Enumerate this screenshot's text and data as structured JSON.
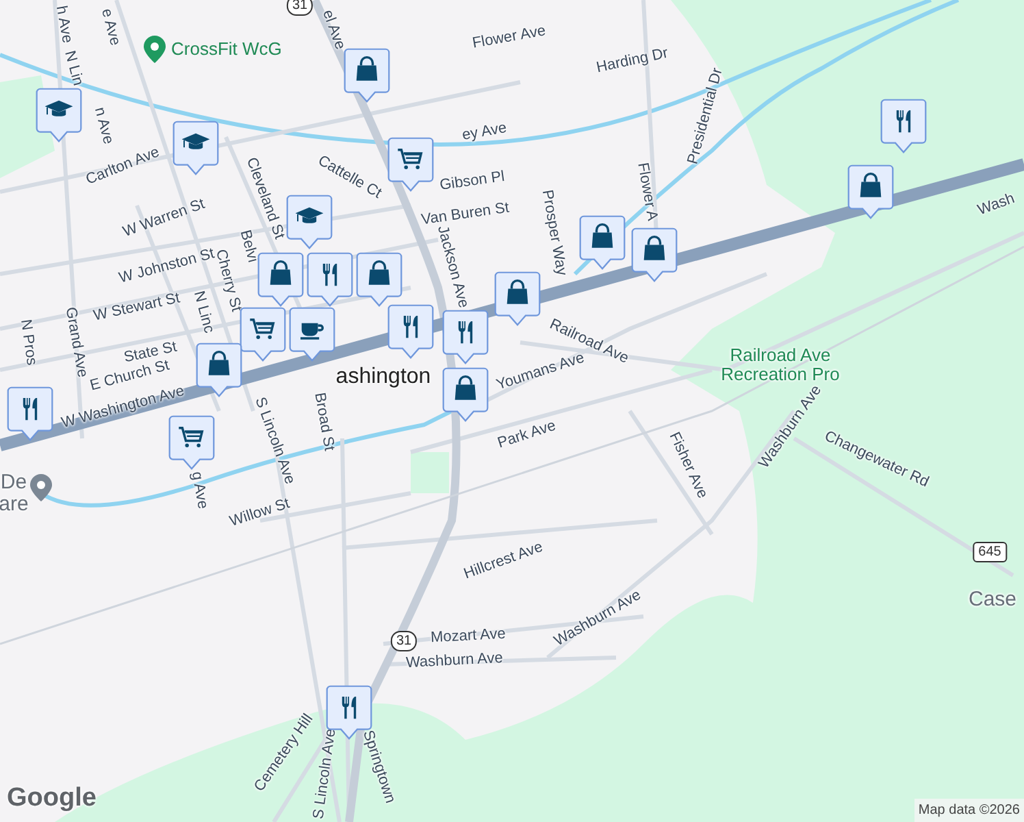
{
  "map": {
    "labels": [
      {
        "text": "h Ave",
        "kind": "street"
      },
      {
        "text": "e Ave",
        "kind": "street"
      },
      {
        "text": "el Ave",
        "kind": "street"
      },
      {
        "text": "Flower Ave",
        "kind": "street"
      },
      {
        "text": "Harding Dr",
        "kind": "street"
      },
      {
        "text": "Presidential Dr",
        "kind": "street"
      },
      {
        "text": "ey Ave",
        "kind": "street"
      },
      {
        "text": "N Lin",
        "kind": "street"
      },
      {
        "text": "n Ave",
        "kind": "street"
      },
      {
        "text": "Carlton Ave",
        "kind": "street"
      },
      {
        "text": "Cattelle Ct",
        "kind": "street"
      },
      {
        "text": "Gibson Pl",
        "kind": "street"
      },
      {
        "text": "W Warren St",
        "kind": "street"
      },
      {
        "text": "Cleveland St",
        "kind": "street"
      },
      {
        "text": "Van Buren St",
        "kind": "street"
      },
      {
        "text": "Prosper Way",
        "kind": "street"
      },
      {
        "text": "Flower A",
        "kind": "street"
      },
      {
        "text": "Jackson Ave",
        "kind": "street"
      },
      {
        "text": "W Johnston St",
        "kind": "street"
      },
      {
        "text": "Belvi",
        "kind": "street"
      },
      {
        "text": "Cherry St",
        "kind": "street"
      },
      {
        "text": "W Stewart St",
        "kind": "street"
      },
      {
        "text": "N Linc",
        "kind": "street"
      },
      {
        "text": "N Pros",
        "kind": "street"
      },
      {
        "text": "Grand Ave",
        "kind": "street"
      },
      {
        "text": "State St",
        "kind": "street"
      },
      {
        "text": "E Church St",
        "kind": "street"
      },
      {
        "text": "W Washington Ave",
        "kind": "street"
      },
      {
        "text": "ashington",
        "kind": "town"
      },
      {
        "text": "Broad St",
        "kind": "street"
      },
      {
        "text": "S Lincoln Ave",
        "kind": "street"
      },
      {
        "text": "Railroad Ave",
        "kind": "street"
      },
      {
        "text": "Youmans Ave",
        "kind": "street"
      },
      {
        "text": "Park Ave",
        "kind": "street"
      },
      {
        "text": "Railroad Ave\nRecreation Pro",
        "kind": "park"
      },
      {
        "text": "Wash",
        "kind": "street"
      },
      {
        "text": "Washburn Ave",
        "kind": "street"
      },
      {
        "text": "Changewater Rd",
        "kind": "street"
      },
      {
        "text": "Fisher Ave",
        "kind": "street"
      },
      {
        "text": "g Ave",
        "kind": "street"
      },
      {
        "text": "Willow St",
        "kind": "street"
      },
      {
        "text": "De\nare",
        "kind": "place"
      },
      {
        "text": "Hillcrest Ave",
        "kind": "street"
      },
      {
        "text": "Case",
        "kind": "place"
      },
      {
        "text": "Mozart Ave",
        "kind": "street"
      },
      {
        "text": "Washburn Ave",
        "kind": "street"
      },
      {
        "text": "Washburn Ave",
        "kind": "street"
      },
      {
        "text": "Cemetery Hill",
        "kind": "street"
      },
      {
        "text": "S Lincoln Ave",
        "kind": "street"
      },
      {
        "text": "Springtown",
        "kind": "street"
      }
    ],
    "poi": {
      "text": "CrossFit WcG"
    },
    "shields": [
      "31",
      "31",
      "645"
    ],
    "markers": [
      {
        "kind": "shop"
      },
      {
        "kind": "school"
      },
      {
        "kind": "school"
      },
      {
        "kind": "cart"
      },
      {
        "kind": "school"
      },
      {
        "kind": "shop"
      },
      {
        "kind": "food"
      },
      {
        "kind": "shop"
      },
      {
        "kind": "cafe"
      },
      {
        "kind": "cart"
      },
      {
        "kind": "food"
      },
      {
        "kind": "food"
      },
      {
        "kind": "shop"
      },
      {
        "kind": "shop"
      },
      {
        "kind": "shop"
      },
      {
        "kind": "food"
      },
      {
        "kind": "cart"
      },
      {
        "kind": "shop"
      },
      {
        "kind": "shop"
      },
      {
        "kind": "food"
      },
      {
        "kind": "shop"
      },
      {
        "kind": "food"
      }
    ],
    "logo": "Google",
    "attribution": "Map data ©2026"
  }
}
